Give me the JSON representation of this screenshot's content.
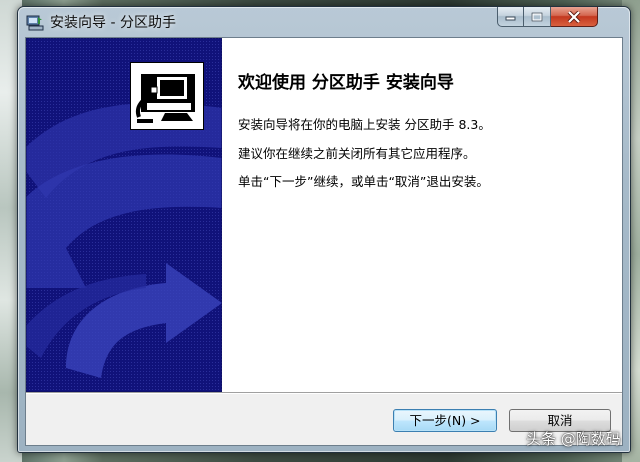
{
  "window": {
    "title": "安装向导 - 分区助手"
  },
  "caption_buttons": {
    "minimize_icon": "minimize-icon",
    "maximize_icon": "maximize-icon",
    "close_icon": "close-icon"
  },
  "wizard": {
    "heading": "欢迎使用 分区助手 安装向导",
    "lines": [
      "安装向导将在你的电脑上安装 分区助手 8.3。",
      "建议你在继续之前关闭所有其它应用程序。",
      "单击“下一步”继续，或单击“取消”退出安装。"
    ],
    "logo_icon": "installer-computer-icon",
    "banner_color": "#10127a"
  },
  "buttons": {
    "next_label": "下一步(N) >",
    "cancel_label": "取消"
  },
  "watermark": {
    "text": "头条 @陶数码"
  }
}
